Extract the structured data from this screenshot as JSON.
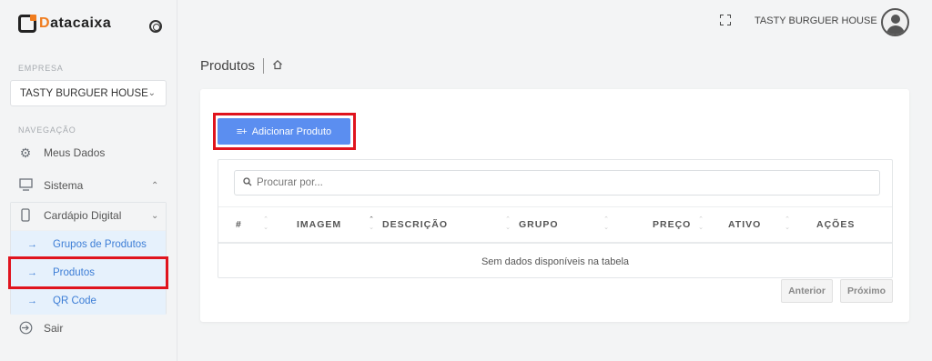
{
  "app": {
    "logo_text_1": "D",
    "logo_text_2": "atacaixa"
  },
  "sidebar": {
    "empresa_label": "EMPRESA",
    "empresa_value": "TASTY BURGUER HOUSE",
    "nav_label": "NAVEGAÇÃO",
    "items": [
      {
        "label": "Meus Dados",
        "icon": "gear-icon"
      },
      {
        "label": "Sistema",
        "icon": "monitor-icon"
      },
      {
        "label": "Cardápio Digital",
        "icon": "mobile-icon"
      },
      {
        "label": "Sair",
        "icon": "logout-icon"
      }
    ],
    "submenu": [
      {
        "label": "Grupos de Produtos"
      },
      {
        "label": "Produtos"
      },
      {
        "label": "QR Code"
      }
    ]
  },
  "header": {
    "user_name": "TASTY BURGUER HOUSE"
  },
  "page": {
    "title": "Produtos"
  },
  "toolbar": {
    "add_label": "Adicionar Produto"
  },
  "table": {
    "search_placeholder": "Procurar por...",
    "columns": [
      "#",
      "IMAGEM",
      "DESCRIÇÃO",
      "GRUPO",
      "PREÇO",
      "ATIVO",
      "AÇÕES"
    ],
    "empty_text": "Sem dados disponíveis na tabela"
  },
  "pagination": {
    "prev": "Anterior",
    "next": "Próximo"
  },
  "colors": {
    "accent": "#5b8ef0",
    "highlight": "#e0141e",
    "brand_orange": "#f07c1e"
  }
}
